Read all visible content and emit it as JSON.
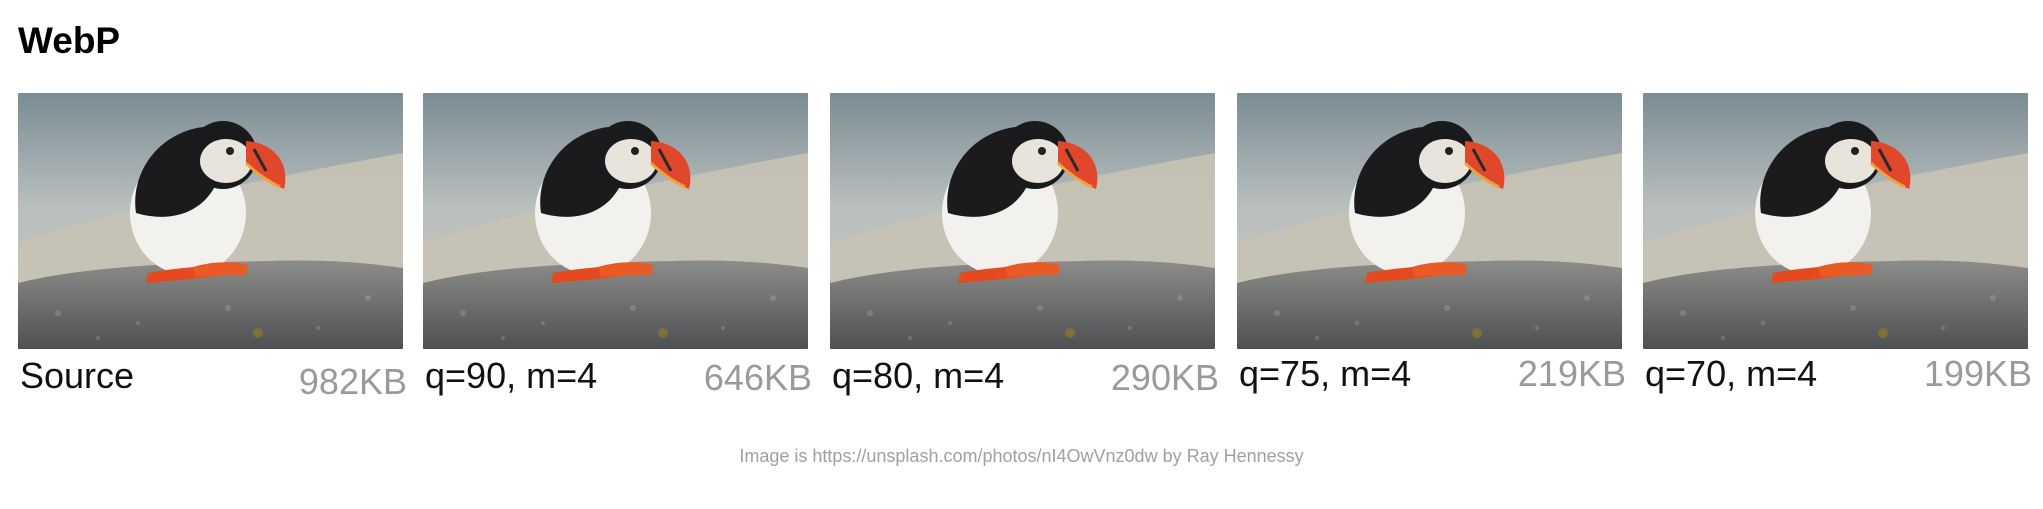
{
  "heading": "WebP",
  "panels": [
    {
      "label": "Source",
      "size": "982KB"
    },
    {
      "label": "q=90, m=4",
      "size": "646KB"
    },
    {
      "label": "q=80, m=4",
      "size": "290KB"
    },
    {
      "label": "q=75, m=4",
      "size": "219KB"
    },
    {
      "label": "q=70, m=4",
      "size": "199KB"
    }
  ],
  "credit": "Image is https://unsplash.com/photos/nI4OwVnz0dw by Ray Hennessy",
  "icons": [
    "puffin-photo"
  ],
  "colors": {
    "size_text": "#9a9a9a",
    "credit_text": "#a0a0a0"
  }
}
